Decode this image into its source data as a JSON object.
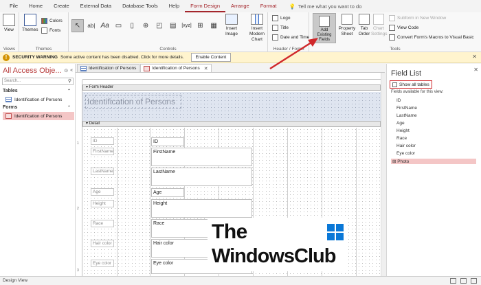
{
  "ribbon_tabs": [
    "File",
    "Home",
    "Create",
    "External Data",
    "Database Tools",
    "Help",
    "Form Design",
    "Arrange",
    "Format"
  ],
  "active_tab": "Form Design",
  "tell_me": "Tell me what you want to do",
  "groups": {
    "views": {
      "label": "Views",
      "view_btn": "View"
    },
    "themes": {
      "label": "Themes",
      "themes_btn": "Themes",
      "colors": "Colors",
      "fonts": "Fonts"
    },
    "controls": {
      "label": "Controls",
      "insert_image": "Insert Image",
      "insert_chart": "Insert Modern Chart"
    },
    "header_footer": {
      "label": "Header / Footer",
      "logo": "Logo",
      "title": "Title",
      "date_time": "Date and Time"
    },
    "tools": {
      "label": "Tools",
      "add_existing_fields": "Add Existing Fields",
      "property_sheet": "Property Sheet",
      "tab_order": "Tab Order",
      "chart_settings": "Chart Settings",
      "subform": "Subform in New Window",
      "view_code": "View Code",
      "convert_macros": "Convert Form's Macros to Visual Basic"
    }
  },
  "security": {
    "title": "SECURITY WARNING",
    "message": "Some active content has been disabled. Click for more details.",
    "button": "Enable Content"
  },
  "nav": {
    "title": "All Access Obje...",
    "search_placeholder": "Search...",
    "tables_header": "Tables",
    "tables": [
      "Identification of Persons"
    ],
    "forms_header": "Forms",
    "forms": [
      "Identification of Persons"
    ]
  },
  "doc_tabs": [
    "Identification of Persons",
    "Identification of Persons"
  ],
  "form": {
    "header_label": "Form Header",
    "header_title": "Identification of Persons",
    "detail_label": "Detail",
    "labels": [
      "ID",
      "FirstName",
      "LastName",
      "Age",
      "Height",
      "Race",
      "Hair color",
      "Eye color"
    ],
    "fields": [
      "ID",
      "FirstName",
      "LastName",
      "Age",
      "Height",
      "Race",
      "Hair color",
      "Eye color"
    ],
    "ruler_numbers": [
      "1",
      "2",
      "3"
    ]
  },
  "field_list": {
    "title": "Field List",
    "show_all": "Show all tables",
    "available": "Fields available for this view:",
    "fields": [
      "ID",
      "FirstName",
      "LastName",
      "Age",
      "Height",
      "Race",
      "Hair color",
      "Eye color",
      "Photo"
    ]
  },
  "status": {
    "text": "Design View"
  },
  "watermark": {
    "line1": "The",
    "line2": "WindowsClub"
  },
  "colors": {
    "accent": "#a4262c",
    "highlight": "#f4c6c6",
    "arrow": "#d0282b"
  }
}
